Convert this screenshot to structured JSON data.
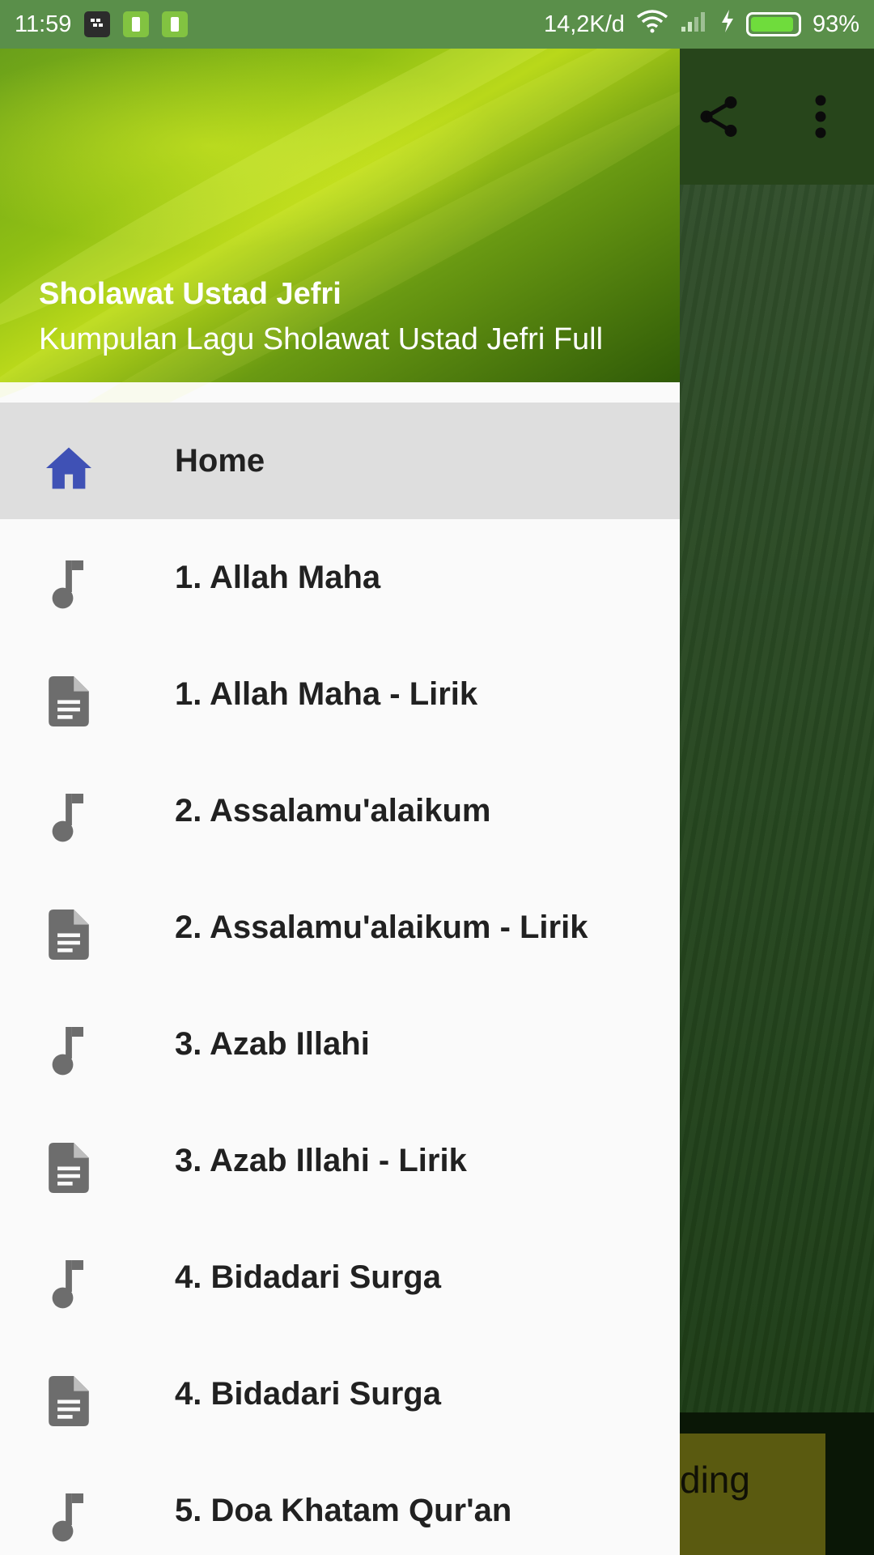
{
  "status_bar": {
    "time": "11:59",
    "network_speed": "14,2K/d",
    "battery": "93%"
  },
  "background_app": {
    "loading_text": "ding"
  },
  "drawer": {
    "header": {
      "title": "Sholawat Ustad Jefri",
      "subtitle": "Kumpulan Lagu Sholawat Ustad Jefri Full"
    },
    "items": [
      {
        "label": "Home",
        "icon": "home-icon",
        "active": true
      },
      {
        "label": "1. Allah Maha",
        "icon": "music-note-icon"
      },
      {
        "label": "1. Allah Maha - Lirik",
        "icon": "document-icon"
      },
      {
        "label": "2. Assalamu'alaikum",
        "icon": "music-note-icon"
      },
      {
        "label": "2. Assalamu'alaikum - Lirik",
        "icon": "document-icon"
      },
      {
        "label": "3. Azab Illahi",
        "icon": "music-note-icon"
      },
      {
        "label": "3. Azab Illahi - Lirik",
        "icon": "document-icon"
      },
      {
        "label": "4. Bidadari Surga",
        "icon": "music-note-icon"
      },
      {
        "label": "4. Bidadari Surga",
        "icon": "document-icon"
      },
      {
        "label": "5. Doa Khatam Qur'an",
        "icon": "music-note-icon"
      }
    ]
  },
  "colors": {
    "status_bar": "#5a8f4a",
    "active_item_bg": "#dedede",
    "home_icon": "#3f51b5",
    "menu_icon": "#6d6d6d"
  }
}
